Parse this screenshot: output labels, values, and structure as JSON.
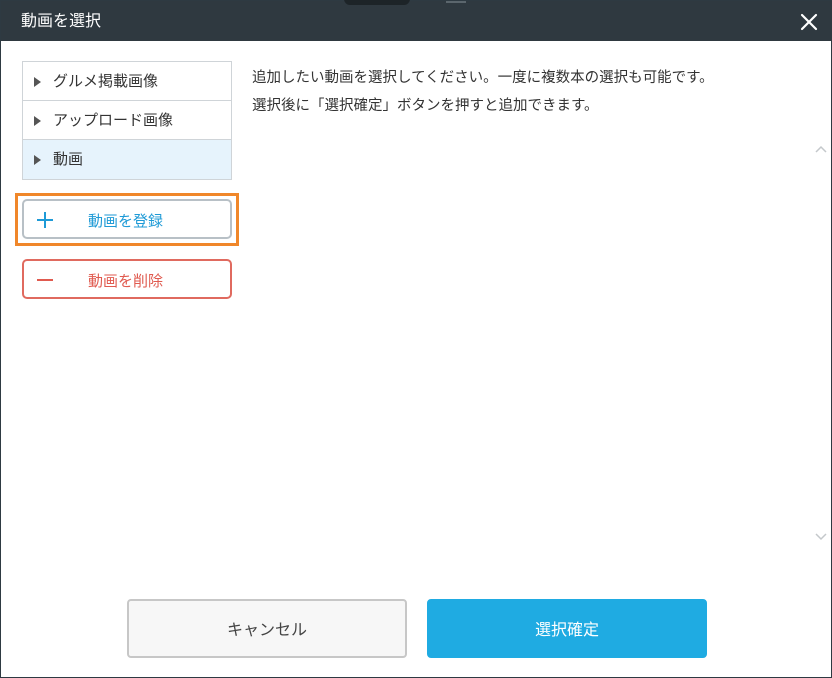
{
  "dialog": {
    "title": "動画を選択"
  },
  "nav": {
    "items": [
      {
        "label": "グルメ掲載画像"
      },
      {
        "label": "アップロード画像"
      },
      {
        "label": "動画"
      }
    ]
  },
  "actions": {
    "register_label": "動画を登録",
    "delete_label": "動画を削除"
  },
  "info": {
    "line1": "追加したい動画を選択してください。一度に複数本の選択も可能です。",
    "line2": "選択後に「選択確定」ボタンを押すと追加できます。"
  },
  "footer": {
    "cancel_label": "キャンセル",
    "confirm_label": "選択確定"
  },
  "colors": {
    "titlebar": "#2f3940",
    "accent": "#1fabe2",
    "danger": "#e05a4f",
    "highlight": "#f0872a",
    "active_nav": "#e6f3fc"
  }
}
